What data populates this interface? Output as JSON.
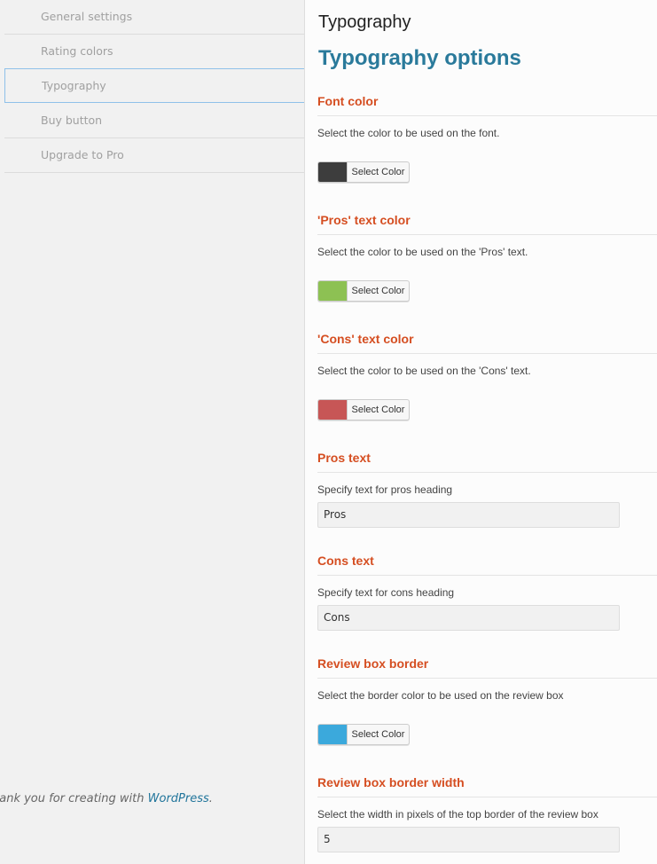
{
  "sidebar": {
    "items": [
      {
        "label": "General settings"
      },
      {
        "label": "Rating colors"
      },
      {
        "label": "Typography"
      },
      {
        "label": "Buy button"
      },
      {
        "label": "Upgrade to Pro"
      }
    ],
    "footer": {
      "text": "hank you for creating with ",
      "link": "WordPress",
      "suffix": "."
    }
  },
  "main": {
    "page_title": "Typography",
    "section_title": "Typography options",
    "options": {
      "font_color": {
        "label": "Font color",
        "description": "Select the color to be used on the font.",
        "button_label": "Select Color",
        "color": "#3d3d3d"
      },
      "pros_color": {
        "label": "'Pros' text color",
        "description": "Select the color to be used on the 'Pros' text.",
        "button_label": "Select Color",
        "color": "#8dc153"
      },
      "cons_color": {
        "label": "'Cons' text color",
        "description": "Select the color to be used on the 'Cons' text.",
        "button_label": "Select Color",
        "color": "#c75656"
      },
      "pros_text": {
        "label": "Pros text",
        "description": "Specify text for pros heading",
        "value": "Pros"
      },
      "cons_text": {
        "label": "Cons text",
        "description": "Specify text for cons heading",
        "value": "Cons"
      },
      "review_border": {
        "label": "Review box border",
        "description": "Select the border color to be used on the review box",
        "button_label": "Select Color",
        "color": "#3ba9dc"
      },
      "review_border_width": {
        "label": "Review box border width",
        "description": "Select the width in pixels of the top border of the review box",
        "value": "5"
      }
    }
  }
}
